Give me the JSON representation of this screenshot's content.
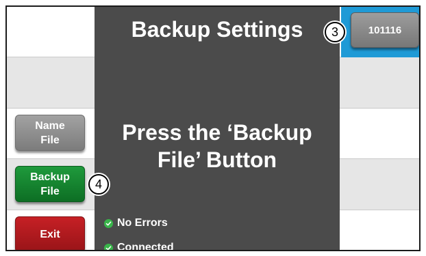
{
  "header": {
    "title": "Backup Settings",
    "id_button_label": "101116"
  },
  "sidebar": {
    "name_file_label": "Name File",
    "backup_file_label": "Backup File",
    "exit_label": "Exit"
  },
  "dialog": {
    "message": "Press the ‘Backup File’ Button",
    "status": [
      {
        "label": "No Errors",
        "icon": "check-circle-icon"
      },
      {
        "label": "Connected",
        "icon": "check-circle-icon"
      }
    ]
  },
  "callouts": {
    "id_button": "3",
    "backup_button": "4"
  },
  "colors": {
    "overlay": "#4b4b4b",
    "row_alt": "#e6e6e6",
    "accent_blue": "#1f9ad6",
    "green_button": "#138432",
    "red_button": "#b0191d",
    "gray_button": "#8e8e8e",
    "status_check": "#39b54a"
  }
}
